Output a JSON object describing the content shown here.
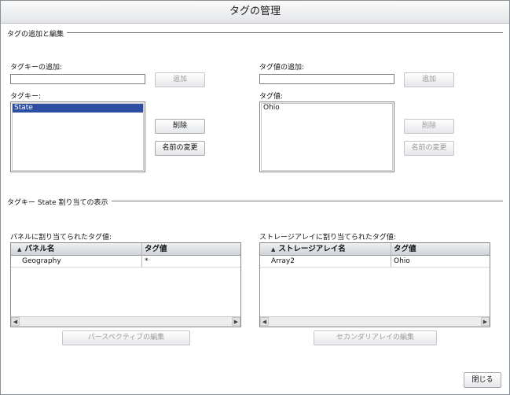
{
  "dialog": {
    "title": "タグの管理",
    "close_label": "閉じる"
  },
  "add_edit": {
    "section_label": "タグの追加と編集",
    "key_add_label": "タグキーの追加:",
    "key_add_value": "",
    "key_add_button": "追加",
    "keys_label": "タグキー:",
    "keys": [
      {
        "label": "State",
        "selected": true
      }
    ],
    "delete_button": "削除",
    "rename_button": "名前の変更",
    "value_add_label": "タグ値の追加:",
    "value_add_value": "",
    "value_add_button": "追加",
    "values_label": "タグ値:",
    "values": [
      {
        "label": "Ohio",
        "selected": false
      }
    ],
    "value_delete_button": "削除",
    "value_rename_button": "名前の変更"
  },
  "assignment": {
    "section_label": "タグキー State 割り当ての表示",
    "panel_table": {
      "label": "パネルに割り当てられたタグ値:",
      "columns": [
        "パネル名",
        "タグ値"
      ],
      "rows": [
        {
          "name": "Geography",
          "value": "*"
        }
      ],
      "edit_button": "パースペクティブの編集"
    },
    "storage_table": {
      "label": "ストレージアレイに割り当てられたタグ値:",
      "columns": [
        "ストレージアレイ名",
        "タグ値"
      ],
      "rows": [
        {
          "name": "Array2",
          "value": "Ohio"
        }
      ],
      "edit_button": "セカンダリアレイの編集"
    }
  },
  "icons": {
    "sort": "sort-asc-icon",
    "scroll_left": "scroll-left-icon",
    "scroll_right": "scroll-right-icon"
  }
}
